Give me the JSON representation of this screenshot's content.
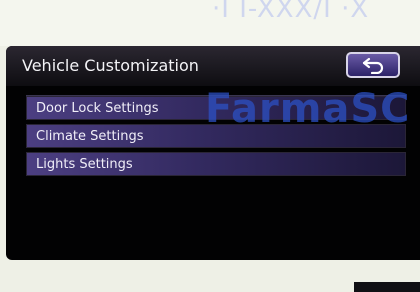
{
  "header": {
    "title": "Vehicle Customization"
  },
  "back_button": {
    "icon": "return-arrow-icon"
  },
  "menu": {
    "items": [
      {
        "label": "Door Lock Settings"
      },
      {
        "label": "Climate Settings"
      },
      {
        "label": "Lights Settings"
      }
    ]
  },
  "overlay": {
    "watermark": "FarmaSC",
    "top_mark": "·I I-XXX/I ·X"
  },
  "colors": {
    "menu_item": "#4c3f82",
    "screen_bg": "#020203",
    "watermark": "#2c52c8"
  }
}
